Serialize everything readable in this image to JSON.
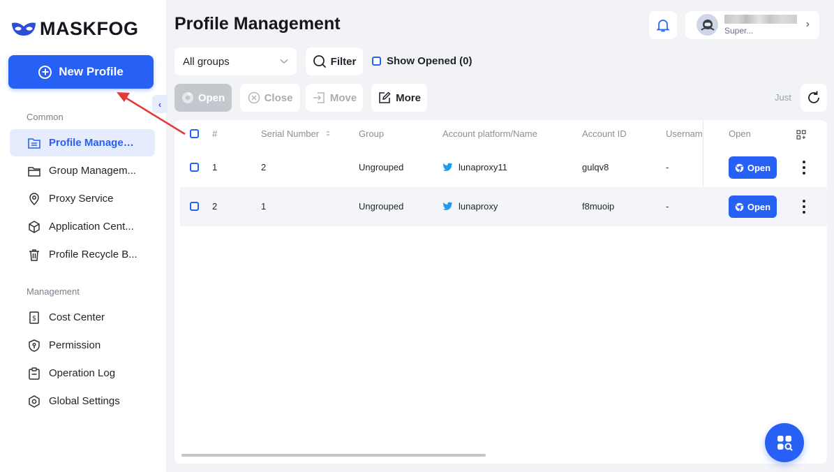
{
  "app": {
    "brand": "MASKFOG"
  },
  "sidebar": {
    "new_profile": "New Profile",
    "sections": [
      {
        "label": "Common",
        "items": [
          {
            "label": "Profile Managem...",
            "icon": "profile-list-icon",
            "active": true
          },
          {
            "label": "Group Managem...",
            "icon": "folder-icon"
          },
          {
            "label": "Proxy Service",
            "icon": "location-pin-icon"
          },
          {
            "label": "Application Cent...",
            "icon": "cube-icon"
          },
          {
            "label": "Profile Recycle B...",
            "icon": "trash-icon"
          }
        ]
      },
      {
        "label": "Management",
        "items": [
          {
            "label": "Cost Center",
            "icon": "receipt-icon"
          },
          {
            "label": "Permission",
            "icon": "shield-key-icon"
          },
          {
            "label": "Operation Log",
            "icon": "clipboard-icon"
          },
          {
            "label": "Global Settings",
            "icon": "hexagon-settings-icon"
          }
        ]
      }
    ]
  },
  "header": {
    "title": "Profile Management",
    "user_sub": "Super..."
  },
  "toolbar": {
    "group_select": "All groups",
    "filter": "Filter",
    "show_opened": "Show Opened (0)",
    "open": "Open",
    "close": "Close",
    "move": "Move",
    "more": "More",
    "last_refresh": "Just"
  },
  "table": {
    "columns": [
      "#",
      "Serial Number",
      "Group",
      "Account platform/Name",
      "Account ID",
      "Usernam",
      "Open"
    ],
    "rows": [
      {
        "index": "1",
        "serial": "2",
        "group": "Ungrouped",
        "account": "lunaproxy11",
        "account_id": "gulqv8",
        "username": "-",
        "open_label": "Open"
      },
      {
        "index": "2",
        "serial": "1",
        "group": "Ungrouped",
        "account": "lunaproxy",
        "account_id": "f8muoip",
        "username": "-",
        "open_label": "Open"
      }
    ]
  },
  "colors": {
    "accent": "#2660f5",
    "annotation_arrow": "#e53935",
    "twitter": "#1d9bf0"
  }
}
